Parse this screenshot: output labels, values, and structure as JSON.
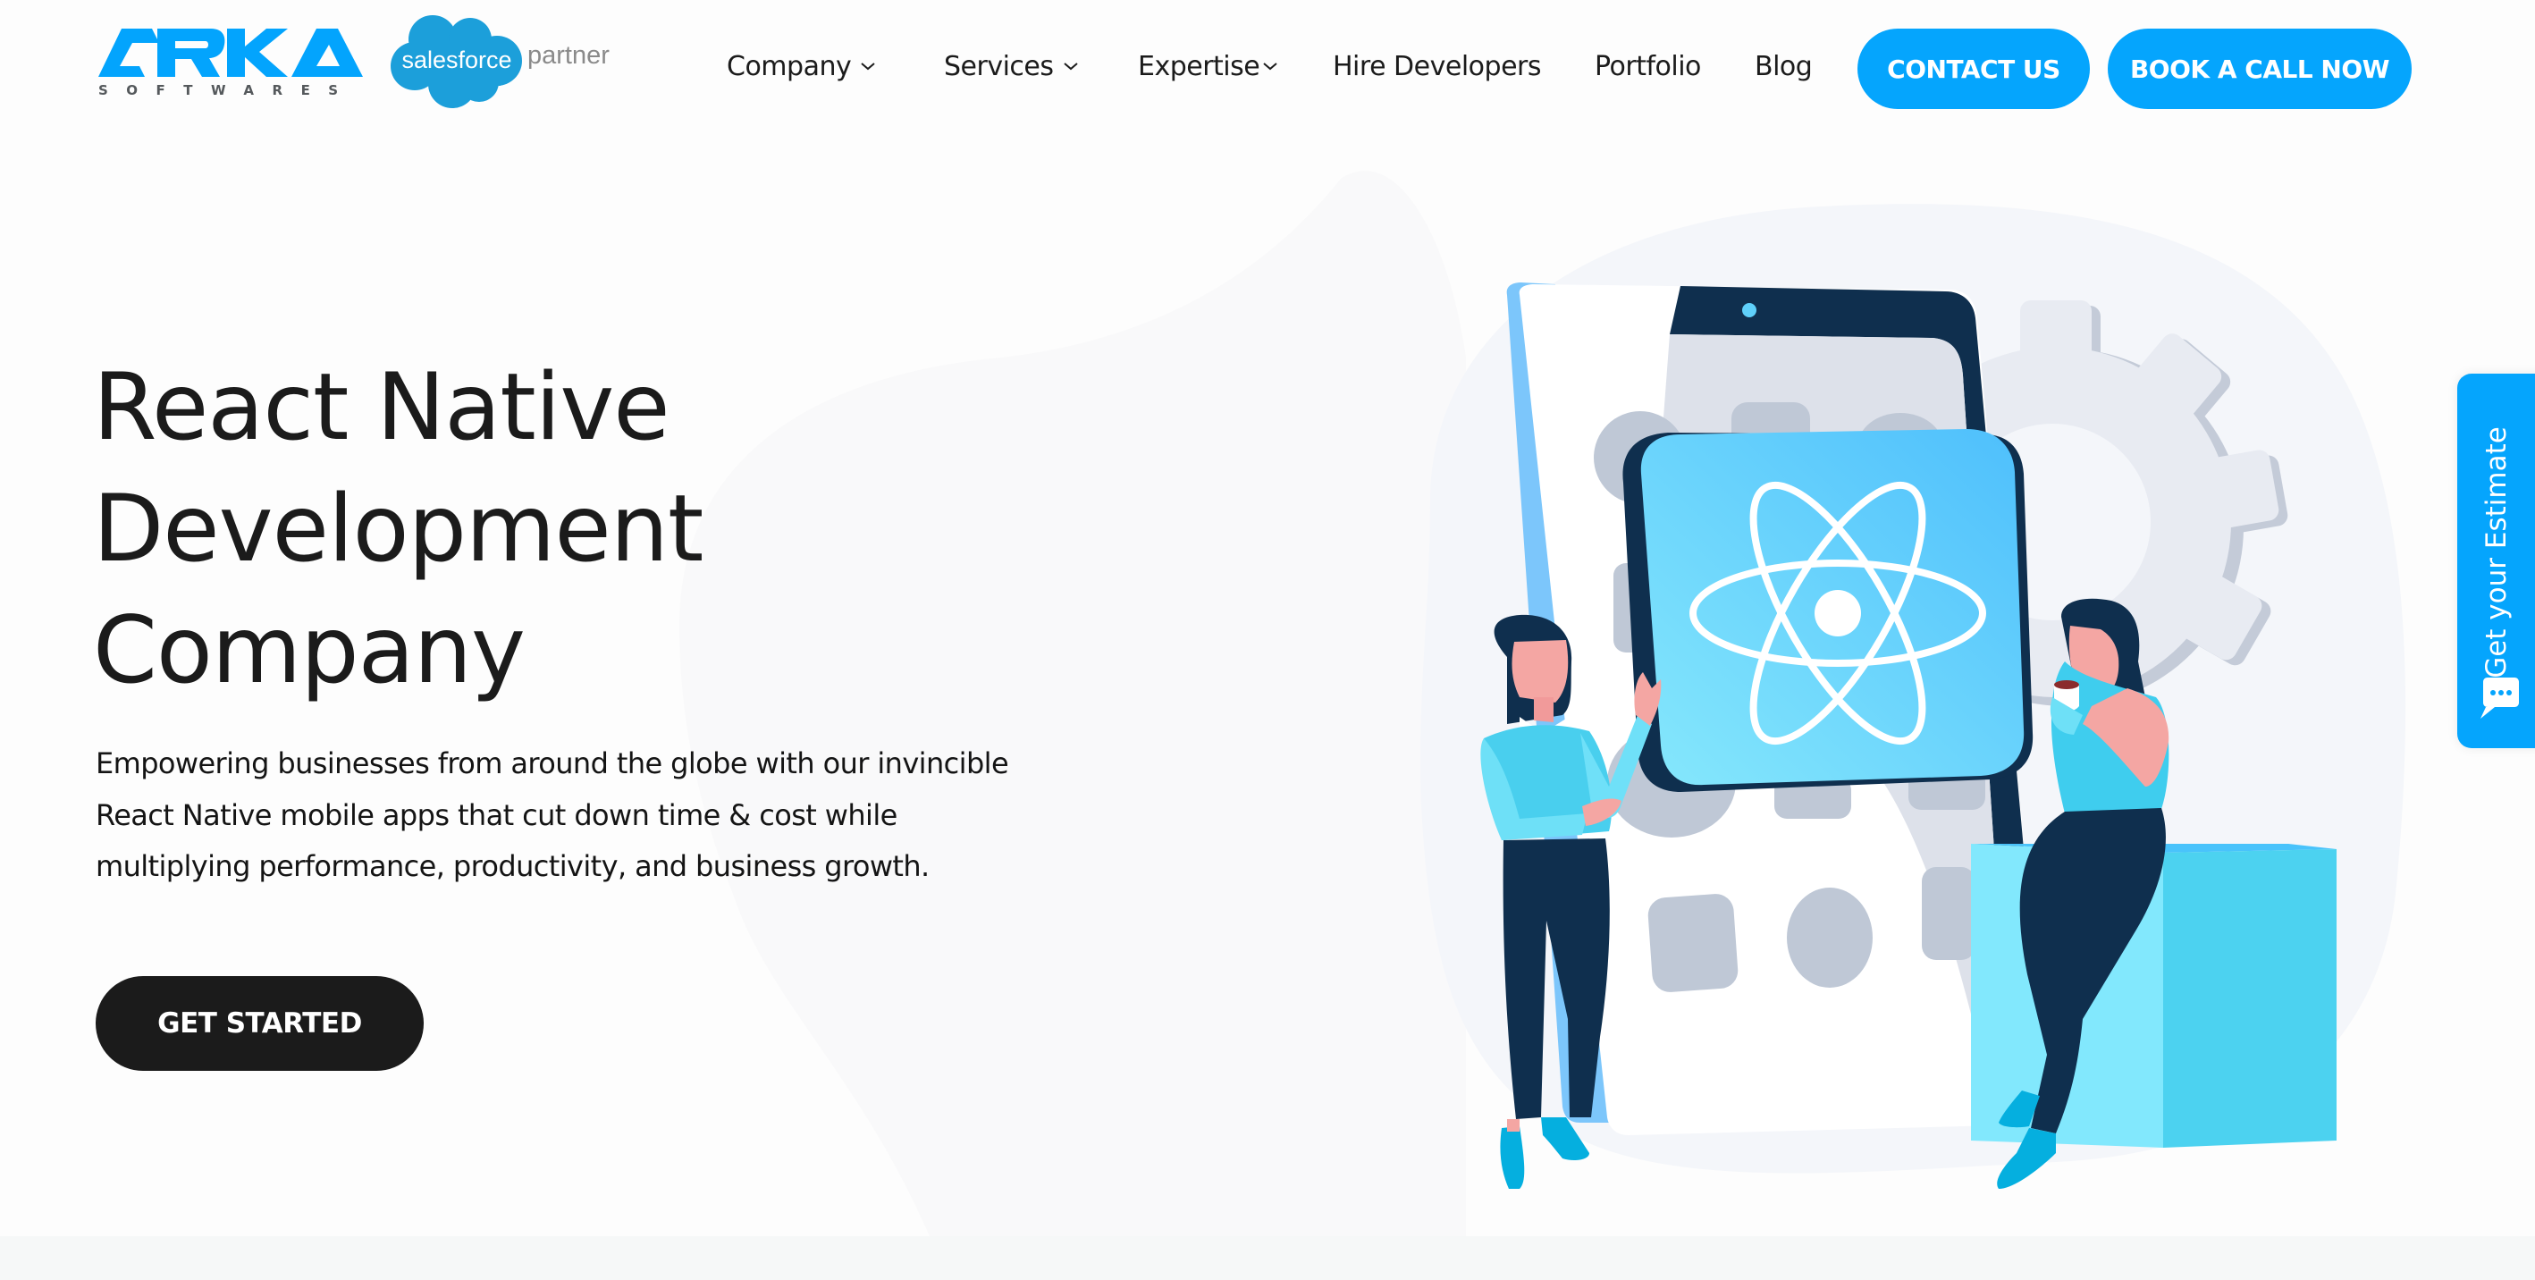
{
  "brand": {
    "logo_text": "ARKA",
    "logo_subtext": "SOFTWARES",
    "partner_badge": "salesforce",
    "partner_label": "partner",
    "accent_color": "#05A5FD",
    "logo_color": "#03A4FD"
  },
  "nav": {
    "items": [
      {
        "label": "Company",
        "has_dropdown": true
      },
      {
        "label": "Services",
        "has_dropdown": true
      },
      {
        "label": "Expertise",
        "has_dropdown": true
      },
      {
        "label": "Hire Developers",
        "has_dropdown": false
      },
      {
        "label": "Portfolio",
        "has_dropdown": false
      },
      {
        "label": "Blog",
        "has_dropdown": false
      }
    ],
    "contact_label": "CONTACT US",
    "book_label": "BOOK A CALL NOW"
  },
  "hero": {
    "title_lines": [
      "React Native",
      "Development",
      "Company"
    ],
    "description": "Empowering businesses from around the globe with our invincible React Native mobile apps that cut down time & cost while multiplying performance, productivity, and business growth.",
    "cta_label": "GET STARTED",
    "cta_color": "#1B1B1B"
  },
  "illustration": {
    "subject": "react-native-mobile-app-illustration",
    "icons": [
      "phone-icon",
      "react-logo-icon",
      "gear-icon"
    ]
  },
  "side_tab": {
    "label": "Get your Estimate",
    "icon": "chat-bubble-icon"
  }
}
